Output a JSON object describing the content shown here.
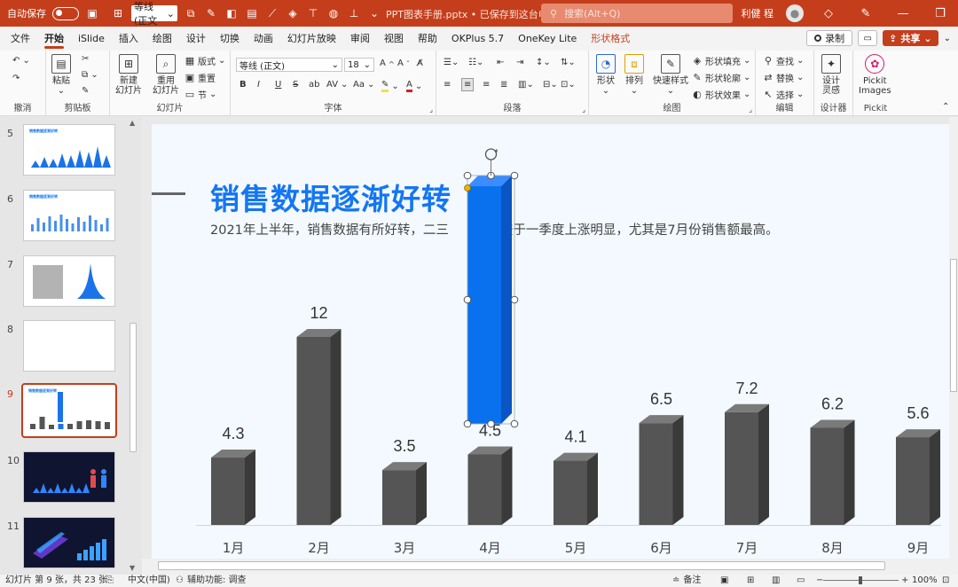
{
  "titlebar": {
    "autosave_label": "自动保存",
    "autosave_state": "关",
    "font_name": "等线 (正文",
    "doc_title": "PPT图表手册.pptx • 已保存到这台电脑",
    "search_placeholder": "搜索(Alt+Q)",
    "user_name": "利健 程"
  },
  "menu": {
    "tabs": [
      "文件",
      "开始",
      "iSlide",
      "插入",
      "绘图",
      "设计",
      "切换",
      "动画",
      "幻灯片放映",
      "审阅",
      "视图",
      "帮助",
      "OKPlus 5.7",
      "OneKey Lite",
      "形状格式"
    ],
    "active_tab": "开始",
    "record_label": "录制",
    "share_label": "共享"
  },
  "ribbon": {
    "undo_group": "撤消",
    "clipboard": {
      "paste": "粘贴",
      "group": "剪贴板"
    },
    "slides": {
      "new_slide": "新建\n幻灯片",
      "reuse_slide": "重用\n幻灯片",
      "layout": "版式",
      "reset": "重置",
      "section": "节",
      "group": "幻灯片"
    },
    "font": {
      "name": "等线 (正文)",
      "size": "18",
      "group": "字体",
      "bold": "B",
      "italic": "I",
      "underline": "U",
      "strike": "S",
      "shadow": "ab",
      "spacing": "AV",
      "case": "Aa"
    },
    "paragraph": {
      "group": "段落"
    },
    "drawing": {
      "shape": "形状",
      "arrange": "排列",
      "quick_styles": "快速样式",
      "fill": "形状填充",
      "outline": "形状轮廓",
      "effects": "形状效果",
      "group": "绘图"
    },
    "editing": {
      "find": "查找",
      "replace": "替换",
      "select": "选择",
      "group": "编辑"
    },
    "designer": {
      "label": "设计\n灵感",
      "group": "设计器"
    },
    "pickit": {
      "label": "Pickit\nImages",
      "group": "Pickit"
    }
  },
  "thumbnails": {
    "slides": [
      {
        "num": "5",
        "title": "销售数据逐渐好转"
      },
      {
        "num": "6",
        "title": "销售数据逐渐好转"
      },
      {
        "num": "7",
        "title": ""
      },
      {
        "num": "8",
        "title": ""
      },
      {
        "num": "9",
        "title": "销售数据逐渐好转"
      },
      {
        "num": "10",
        "title": ""
      },
      {
        "num": "11",
        "title": ""
      }
    ],
    "selected": "9"
  },
  "slide": {
    "title": "销售数据逐渐好转",
    "subtitle": "2021年上半年，销售数据有所好转，二三　　　比较于一季度上涨明显，尤其是7月份销售额最高。"
  },
  "chart_data": {
    "type": "bar",
    "title": "",
    "categories": [
      "1月",
      "2月",
      "3月",
      "4月",
      "5月",
      "6月",
      "7月",
      "8月",
      "9月"
    ],
    "values": [
      4.3,
      12,
      3.5,
      4.5,
      4.1,
      6.5,
      7.2,
      6.2,
      5.6
    ],
    "value_labels": [
      "4.3",
      "12",
      "3.5",
      "4.5",
      "4.1",
      "6.5",
      "7.2",
      "6.2",
      "5.6"
    ],
    "highlight": {
      "category": "4月",
      "color": "#0a71ee"
    },
    "bar_color": "#555555",
    "ylim": [
      0,
      12
    ],
    "grid": false,
    "legend": "none"
  },
  "statusbar": {
    "slide_info": "幻灯片 第 9 张，共 23 张",
    "language": "中文(中国)",
    "accessibility": "辅助功能: 调查",
    "notes": "备注",
    "zoom": "100%"
  }
}
